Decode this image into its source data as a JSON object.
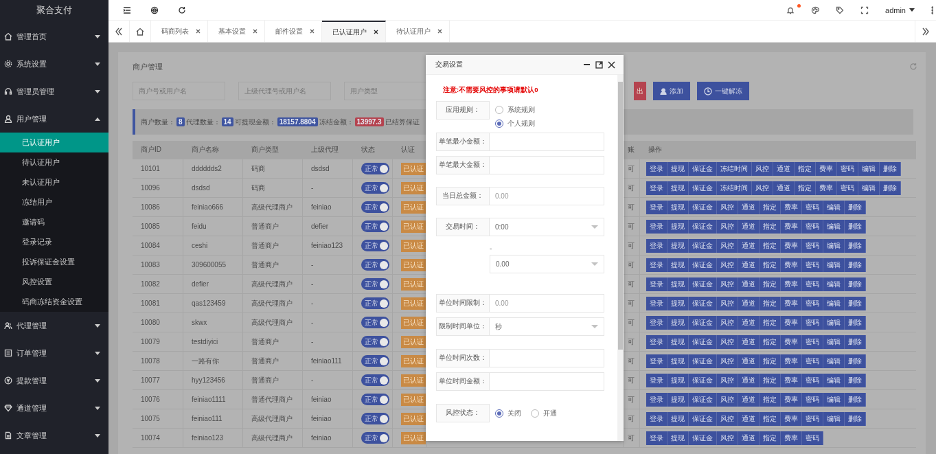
{
  "sidebar": {
    "logo": "聚合支付",
    "items": [
      {
        "label": "管理首页",
        "expanded": false
      },
      {
        "label": "系统设置",
        "expanded": false
      },
      {
        "label": "管理员管理",
        "expanded": false
      },
      {
        "label": "用户管理",
        "expanded": true,
        "children": [
          {
            "label": "已认证用户",
            "selected": true
          },
          {
            "label": "待认证用户",
            "selected": false
          },
          {
            "label": "未认证用户",
            "selected": false
          },
          {
            "label": "冻结用户",
            "selected": false
          },
          {
            "label": "邀请码",
            "selected": false
          },
          {
            "label": "登录记录",
            "selected": false
          },
          {
            "label": "投诉保证金设置",
            "selected": false
          },
          {
            "label": "风控设置",
            "selected": false
          },
          {
            "label": "码商冻结资金设置",
            "selected": false
          }
        ]
      },
      {
        "label": "代理管理",
        "expanded": false
      },
      {
        "label": "订单管理",
        "expanded": false
      },
      {
        "label": "提款管理",
        "expanded": false
      },
      {
        "label": "通道管理",
        "expanded": false
      },
      {
        "label": "文章管理",
        "expanded": false
      }
    ]
  },
  "header": {
    "notification_unread": true,
    "user": "admin"
  },
  "tabs": [
    {
      "label": "码商列表",
      "selected": false
    },
    {
      "label": "基本设置",
      "selected": false
    },
    {
      "label": "邮件设置",
      "selected": false
    },
    {
      "label": "已认证用户",
      "selected": true
    },
    {
      "label": "待认证用户",
      "selected": false
    }
  ],
  "panel": {
    "title": "商户管理",
    "search": [
      {
        "placeholder": "商户号或用户名"
      },
      {
        "placeholder": "上级代理号或用户名"
      },
      {
        "placeholder": "用户类型"
      }
    ],
    "buttons": [
      {
        "label": "出",
        "kind": "danger"
      },
      {
        "label": "添加",
        "kind": "add"
      },
      {
        "label": "一键解冻",
        "kind": "unfreeze"
      }
    ],
    "stats": [
      {
        "label": "商户数量：",
        "value": "8",
        "color": "#3f55a0"
      },
      {
        "label": "代理数量：",
        "value": "14",
        "color": "#3f55a0"
      },
      {
        "label": "可提现金额：",
        "value": "18157.8804",
        "color": "#3f55a0"
      },
      {
        "label": "冻结金额：",
        "value": "13997.3",
        "color": "#b5434f"
      },
      {
        "label": "已结算保证"
      }
    ],
    "table": {
      "columns": [
        "商户ID",
        "商户名称",
        "商户类型",
        "上级代理",
        "状态",
        "认证",
        "账",
        "操作"
      ],
      "rows": [
        {
          "id": "10101",
          "name": "dddddds2",
          "type": "码商",
          "parent": "dsdsd",
          "status": "正常",
          "on": true,
          "auth": "已认证",
          "account": "可",
          "actions": [
            "登录",
            "提现",
            "保证金",
            "冻结时间",
            "风控",
            "通道",
            "指定",
            "费率",
            "密码",
            "编辑",
            "删除"
          ]
        },
        {
          "id": "10096",
          "name": "dsdsd",
          "type": "码商",
          "parent": "-",
          "status": "正常",
          "on": true,
          "auth": "已认证",
          "account": "可",
          "actions": [
            "登录",
            "提现",
            "保证金",
            "冻结时间",
            "风控",
            "通道",
            "指定",
            "费率",
            "密码",
            "编辑",
            "删除"
          ]
        },
        {
          "id": "10086",
          "name": "feiniao666",
          "type": "高级代理商户",
          "parent": "feiniao",
          "status": "正常",
          "on": true,
          "auth": "已认证",
          "account": "可",
          "actions": [
            "登录",
            "提现",
            "保证金",
            "风控",
            "通道",
            "指定",
            "费率",
            "密码",
            "编辑",
            "删除"
          ]
        },
        {
          "id": "10085",
          "name": "feidu",
          "type": "普通商户",
          "parent": "defier",
          "status": "正常",
          "on": true,
          "auth": "已认证",
          "account": "可",
          "actions": [
            "登录",
            "提现",
            "保证金",
            "风控",
            "通道",
            "指定",
            "费率",
            "密码",
            "编辑",
            "删除"
          ]
        },
        {
          "id": "10084",
          "name": "ceshi",
          "type": "普通商户",
          "parent": "feiniao123",
          "status": "正常",
          "on": true,
          "auth": "已认证",
          "account": "可",
          "actions": [
            "登录",
            "提现",
            "保证金",
            "风控",
            "通道",
            "指定",
            "费率",
            "密码",
            "编辑",
            "删除"
          ]
        },
        {
          "id": "10083",
          "name": "309600055",
          "type": "普通商户",
          "parent": "-",
          "status": "正常",
          "on": true,
          "auth": "已认证",
          "account": "可",
          "actions": [
            "登录",
            "提现",
            "保证金",
            "风控",
            "通道",
            "指定",
            "费率",
            "密码",
            "编辑",
            "删除"
          ]
        },
        {
          "id": "10082",
          "name": "defier",
          "type": "高级代理商户",
          "parent": "-",
          "status": "正常",
          "on": true,
          "auth": "已认证",
          "account": "可",
          "actions": [
            "登录",
            "提现",
            "保证金",
            "风控",
            "通道",
            "指定",
            "费率",
            "密码",
            "编辑",
            "删除"
          ]
        },
        {
          "id": "10081",
          "name": "qas123459",
          "type": "高级代理商户",
          "parent": "-",
          "status": "正常",
          "on": true,
          "auth": "已认证",
          "account": "可",
          "actions": [
            "登录",
            "提现",
            "保证金",
            "风控",
            "通道",
            "指定",
            "费率",
            "密码",
            "编辑",
            "删除"
          ]
        },
        {
          "id": "10080",
          "name": "skwx",
          "type": "高级代理商户",
          "parent": "-",
          "status": "正常",
          "on": true,
          "auth": "已认证",
          "account": "可",
          "actions": [
            "登录",
            "提现",
            "保证金",
            "风控",
            "通道",
            "指定",
            "费率",
            "密码",
            "编辑",
            "删除"
          ]
        },
        {
          "id": "10079",
          "name": "testdiyici",
          "type": "普通商户",
          "parent": "-",
          "status": "正常",
          "on": true,
          "auth": "已认证",
          "account": "可",
          "actions": [
            "登录",
            "提现",
            "保证金",
            "风控",
            "通道",
            "指定",
            "费率",
            "密码",
            "编辑",
            "删除"
          ]
        },
        {
          "id": "10078",
          "name": "一路有你",
          "type": "普通商户",
          "parent": "feiniao111",
          "status": "正常",
          "on": true,
          "auth": "已认证",
          "account": "可",
          "actions": [
            "登录",
            "提现",
            "保证金",
            "风控",
            "通道",
            "指定",
            "费率",
            "密码",
            "编辑",
            "删除"
          ]
        },
        {
          "id": "10077",
          "name": "hyy123456",
          "type": "普通商户",
          "parent": "-",
          "status": "正常",
          "on": true,
          "auth": "已认证",
          "account": "可",
          "actions": [
            "登录",
            "提现",
            "保证金",
            "风控",
            "通道",
            "指定",
            "费率",
            "密码",
            "编辑",
            "删除"
          ]
        },
        {
          "id": "10076",
          "name": "feiniao1111",
          "type": "普通代理商户",
          "parent": "feiniao",
          "status": "正常",
          "on": true,
          "auth": "已认证",
          "account": "可",
          "actions": [
            "登录",
            "提现",
            "保证金",
            "风控",
            "通道",
            "指定",
            "费率",
            "密码",
            "编辑",
            "删除"
          ]
        },
        {
          "id": "10075",
          "name": "feiniao111",
          "type": "高级代理商户",
          "parent": "feiniao",
          "status": "正常",
          "on": true,
          "auth": "已认证",
          "account": "可",
          "actions": [
            "登录",
            "提现",
            "保证金",
            "风控",
            "通道",
            "指定",
            "费率",
            "密码",
            "编辑",
            "删除"
          ]
        },
        {
          "id": "10074",
          "name": "feiniao123",
          "type": "高级代理商户",
          "parent": "feiniao",
          "status": "正常",
          "on": true,
          "auth": "已认证",
          "account": "可",
          "actions": [
            "登录",
            "提现",
            "保证金",
            "风控",
            "通道",
            "指定",
            "费率",
            "密码"
          ]
        }
      ]
    }
  },
  "modal": {
    "title": "交易设置",
    "notice": "注意:不需要风控的事项请默认0",
    "fields": [
      {
        "kind": "radio_list",
        "label": "应用规则：",
        "options": [
          {
            "label": "系统规则",
            "selected": false
          },
          {
            "label": "个人规则",
            "selected": true
          }
        ]
      },
      {
        "kind": "input",
        "label": "单笔最小金额："
      },
      {
        "kind": "input",
        "label": "单笔最大金额："
      },
      {
        "kind": "input",
        "label": "当日总金额：",
        "placeholder": "0.00"
      },
      {
        "kind": "select",
        "label": "交易时间：",
        "value": "0:00"
      },
      {
        "kind": "range_end",
        "separator": "-",
        "value": "0.00"
      },
      {
        "kind": "input",
        "label": "单位时间限制：",
        "placeholder": "0.00"
      },
      {
        "kind": "select",
        "label": "限制时间单位：",
        "value": "秒"
      },
      {
        "kind": "input",
        "label": "单位时间次数："
      },
      {
        "kind": "input",
        "label": "单位时间金额："
      },
      {
        "kind": "radio_row",
        "label": "风控状态：",
        "options": [
          {
            "label": "关闭",
            "selected": true
          },
          {
            "label": "开通",
            "selected": false
          }
        ]
      }
    ]
  }
}
